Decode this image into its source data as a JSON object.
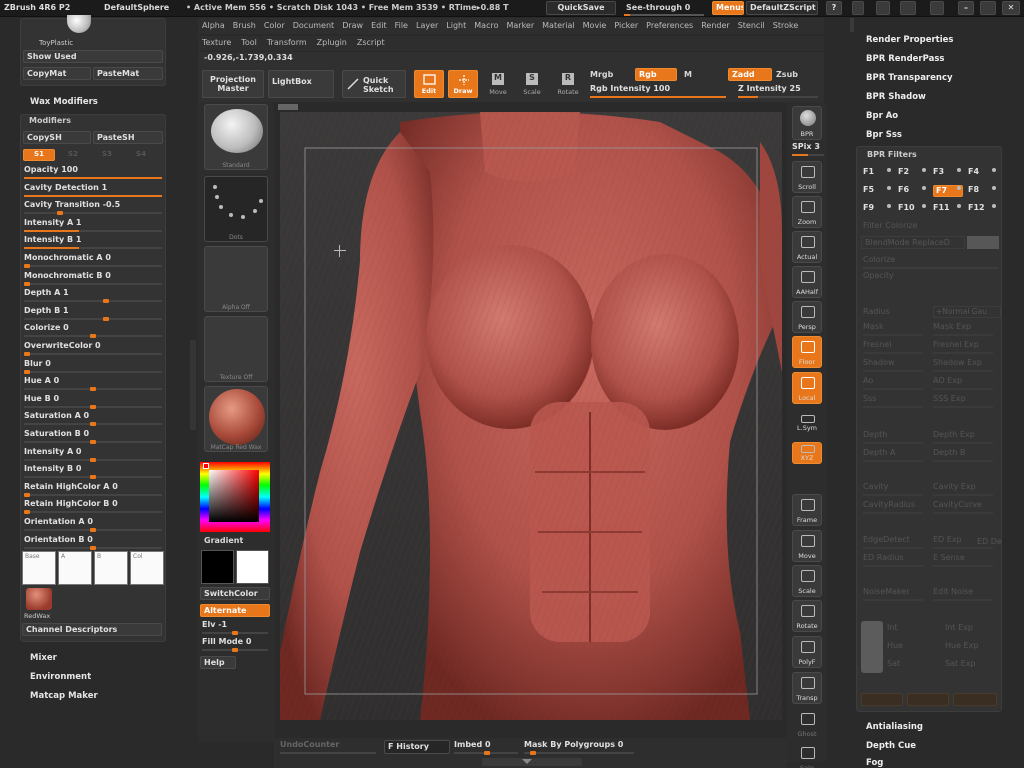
{
  "titlebar": {
    "app": "ZBrush 4R6 P2",
    "document": "DefaultSphere",
    "stats": "• Active Mem 556 • Scratch Disk 1043 • Free Mem 3539 • RTime▸0.88 T",
    "quicksave": "QuickSave",
    "seethrough": "See-through  0",
    "menus": "Menus",
    "script": "DefaultZScript"
  },
  "menu": {
    "row1": [
      "Alpha",
      "Brush",
      "Color",
      "Document",
      "Draw",
      "Edit",
      "File",
      "Layer",
      "Light",
      "Macro",
      "Marker",
      "Material",
      "Movie",
      "Picker",
      "Preferences",
      "Render",
      "Stencil",
      "Stroke"
    ],
    "row2": [
      "Texture",
      "Tool",
      "Transform",
      "Zplugin",
      "Zscript"
    ]
  },
  "coords": "-0.926,-1.739,0.334",
  "shelf": {
    "projection": "Projection Master",
    "lightbox": "LightBox",
    "quick_sketch": "Quick Sketch",
    "edit": "Edit",
    "draw": "Draw",
    "move": "Move",
    "scale": "Scale",
    "rotate": "Rotate",
    "mrgb": "Mrgb",
    "rgb": "Rgb",
    "m": "M",
    "zadd": "Zadd",
    "zsub": "Zsub",
    "rgb_intensity": "Rgb Intensity 100",
    "z_intensity": "Z Intensity 25"
  },
  "left": {
    "material_name": "ToyPlastic",
    "show_used": "Show Used",
    "copymat": "CopyMat",
    "pastemat": "PasteMat",
    "wax_modifiers": "Wax Modifiers",
    "modifiers": "Modifiers",
    "copysh": "CopySH",
    "pastesh": "PasteSH",
    "s_buttons": [
      "S1",
      "S2",
      "S3",
      "S4"
    ],
    "sliders": [
      {
        "label": "Opacity 100",
        "value": 1.0
      },
      {
        "label": "Cavity Detection 1",
        "value": 1.0
      },
      {
        "label": "Cavity Transition -0.5",
        "value": 0.25
      },
      {
        "label": "Intensity A 1",
        "value": 0.4
      },
      {
        "label": "Intensity B 1",
        "value": 0.4
      },
      {
        "label": "Monochromatic A 0",
        "value": 0
      },
      {
        "label": "Monochromatic B 0",
        "value": 0
      },
      {
        "label": "Depth A 1",
        "value": 0.6
      },
      {
        "label": "Depth B 1",
        "value": 0.6
      },
      {
        "label": "Colorize 0",
        "value": 0.5
      },
      {
        "label": "OverwriteColor 0",
        "value": 0
      },
      {
        "label": "Blur 0",
        "value": 0
      },
      {
        "label": "Hue A 0",
        "value": 0.5
      },
      {
        "label": "Hue B 0",
        "value": 0.5
      },
      {
        "label": "Saturation A 0",
        "value": 0.5
      },
      {
        "label": "Saturation B 0",
        "value": 0.5
      },
      {
        "label": "Intensity A 0",
        "value": 0.5
      },
      {
        "label": "Intensity B 0",
        "value": 0.5
      },
      {
        "label": "Retain HighColor A 0",
        "value": 0
      },
      {
        "label": "Retain HighColor B 0",
        "value": 0
      },
      {
        "label": "Orientation A 0",
        "value": 0.5
      },
      {
        "label": "Orientation B 0",
        "value": 0.5
      }
    ],
    "swatches": [
      "Base",
      "A",
      "B",
      "Col"
    ],
    "redwax": "RedWax",
    "channel_descriptors": "Channel Descriptors",
    "mixer": "Mixer",
    "environment": "Environment",
    "matcap_maker": "Matcap Maker"
  },
  "tools": {
    "standard": "Standard",
    "dots": "Dots",
    "alpha": "Alpha Off",
    "texture": "Texture Off",
    "material": "MatCap Red Wax",
    "gradient": "Gradient",
    "switchcolor": "SwitchColor",
    "alternate": "Alternate",
    "elv": "Elv -1",
    "fill_mode": "Fill Mode 0",
    "help": "Help"
  },
  "right_shelf": {
    "bpr": "BPR",
    "spix": "SPix 3",
    "buttons": [
      "Scroll",
      "Zoom",
      "Actual",
      "AAHalf",
      "Persp",
      "Floor",
      "Local",
      "L.Sym",
      "XYZ",
      "Frame",
      "Move",
      "Scale",
      "Rotate",
      "PolyF",
      "Transp",
      "Ghost",
      "Solo"
    ]
  },
  "right": {
    "render_properties": "Render Properties",
    "bpr_renderpass": "BPR RenderPass",
    "bpr_transparency": "BPR Transparency",
    "bpr_shadow": "BPR Shadow",
    "bpr_ao": "Bpr Ao",
    "bpr_sss": "Bpr Sss",
    "bpr_filters": "BPR Filters",
    "fkeys": [
      "F1",
      "F2",
      "F3",
      "F4",
      "F5",
      "F6",
      "F7",
      "F8",
      "F9",
      "F10",
      "F11",
      "F12"
    ],
    "filter_colorize": "Filter Colorize",
    "blendmode": "BlendMode ReplaceD",
    "colorize": "Colorize",
    "opacity": "Opacity",
    "radius": "Radius",
    "normal_gau": "+Normal Gau",
    "pairs": [
      [
        "Mask",
        "Mask Exp"
      ],
      [
        "Fresnel",
        "Fresnel Exp"
      ],
      [
        "Shadow",
        "Shadow Exp"
      ],
      [
        "Ao",
        "AO Exp"
      ],
      [
        "Sss",
        "SSS Exp"
      ],
      [
        "Depth",
        "Depth Exp"
      ],
      [
        "Depth A",
        "Depth B"
      ],
      [
        "Cavity",
        "Cavity Exp"
      ],
      [
        "CavityRadius",
        "CavityCurve"
      ],
      [
        "EdgeDetect",
        "ED Exp"
      ],
      [
        "ED Radius",
        "E Sense"
      ],
      [
        "NoiseMaker",
        "Edit Noise"
      ]
    ],
    "ed_de": "ED De",
    "int_pairs": [
      [
        "Int",
        "Int Exp"
      ],
      [
        "Hue",
        "Hue Exp"
      ],
      [
        "Sat",
        "Sat Exp"
      ]
    ],
    "antialiasing": "Antialiasing",
    "depth_cue": "Depth Cue",
    "fog": "Fog"
  },
  "bottom": {
    "undo": "UndoCounter",
    "f_history": "F History",
    "imbed": "Imbed 0",
    "mask_by": "Mask By Polygroups 0"
  },
  "colors": {
    "accent": "#e8761a",
    "skin": "#b5584f"
  }
}
